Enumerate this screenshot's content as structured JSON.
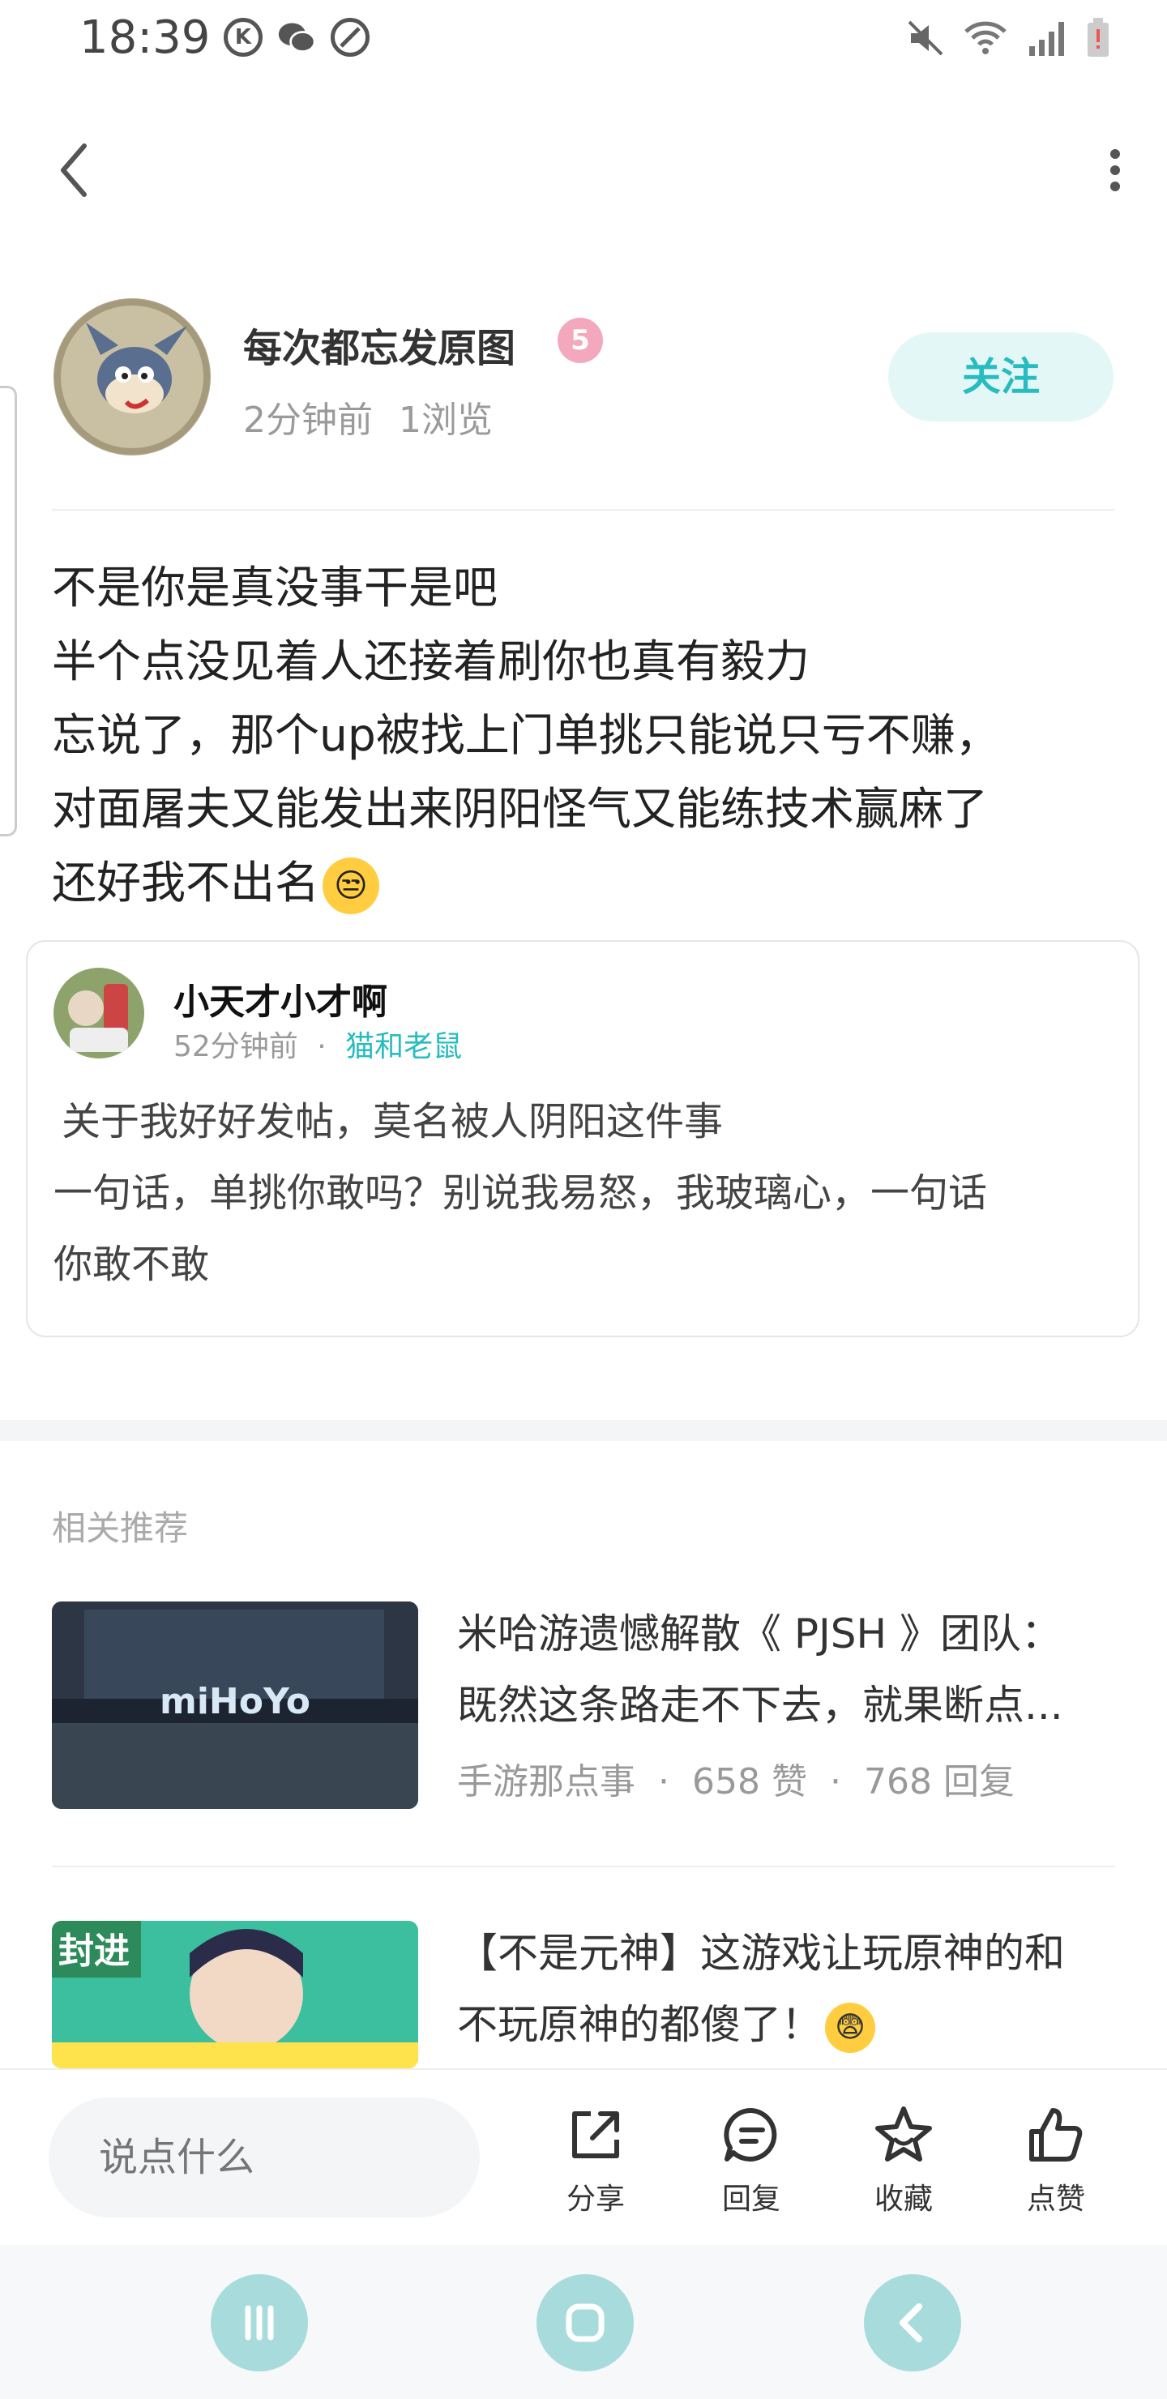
{
  "status_bar": {
    "time": "18:39",
    "left_icons": [
      "k-icon",
      "wechat-icon",
      "blocked-icon"
    ],
    "right_icons": [
      "mute-icon",
      "wifi-icon",
      "signal-icon",
      "battery-icon"
    ]
  },
  "author": {
    "name": "每次都忘发原图",
    "level": "5",
    "time": "2分钟前",
    "views": "1浏览",
    "follow_label": "关注"
  },
  "post": {
    "lines": [
      "不是你是真没事干是吧",
      "半个点没见着人还接着刷你也真有毅力",
      "忘说了，那个up被找上门单挑只能说只亏不赚，",
      "对面屠夫又能发出来阴阳怪气又能练技术赢麻了",
      "还好我不出名"
    ],
    "emoji": "😒"
  },
  "quote": {
    "name": "小天才小才啊",
    "time": "52分钟前",
    "separator": "·",
    "tag": "猫和老鼠",
    "lines": [
      "关于我好好发帖，莫名被人阴阳这件事",
      "一句话，单挑你敢吗？别说我易怒，我玻璃心，一句话",
      "你敢不敢"
    ]
  },
  "related": {
    "title": "相关推荐",
    "items": [
      {
        "title_lines": [
          "米哈游遗憾解散《 PJSH 》团队：",
          "既然这条路走不下去，就果断点..."
        ],
        "source": "手游那点事",
        "likes": "658 赞",
        "replies": "768 回复",
        "sep": "·",
        "thumb_text": "miHoYo"
      },
      {
        "title_lines": [
          "【不是元神】这游戏让玩原神的和",
          "不玩原神的都傻了！"
        ],
        "emoji": "😨",
        "thumb_text": "封进"
      }
    ]
  },
  "bottom_bar": {
    "input_placeholder": "说点什么",
    "share": "分享",
    "reply": "回复",
    "favorite": "收藏",
    "like": "点赞"
  },
  "colors": {
    "accent": "#27bcc0",
    "follow_bg": "#e4f7f7",
    "nav_button": "#a8dcdc"
  }
}
